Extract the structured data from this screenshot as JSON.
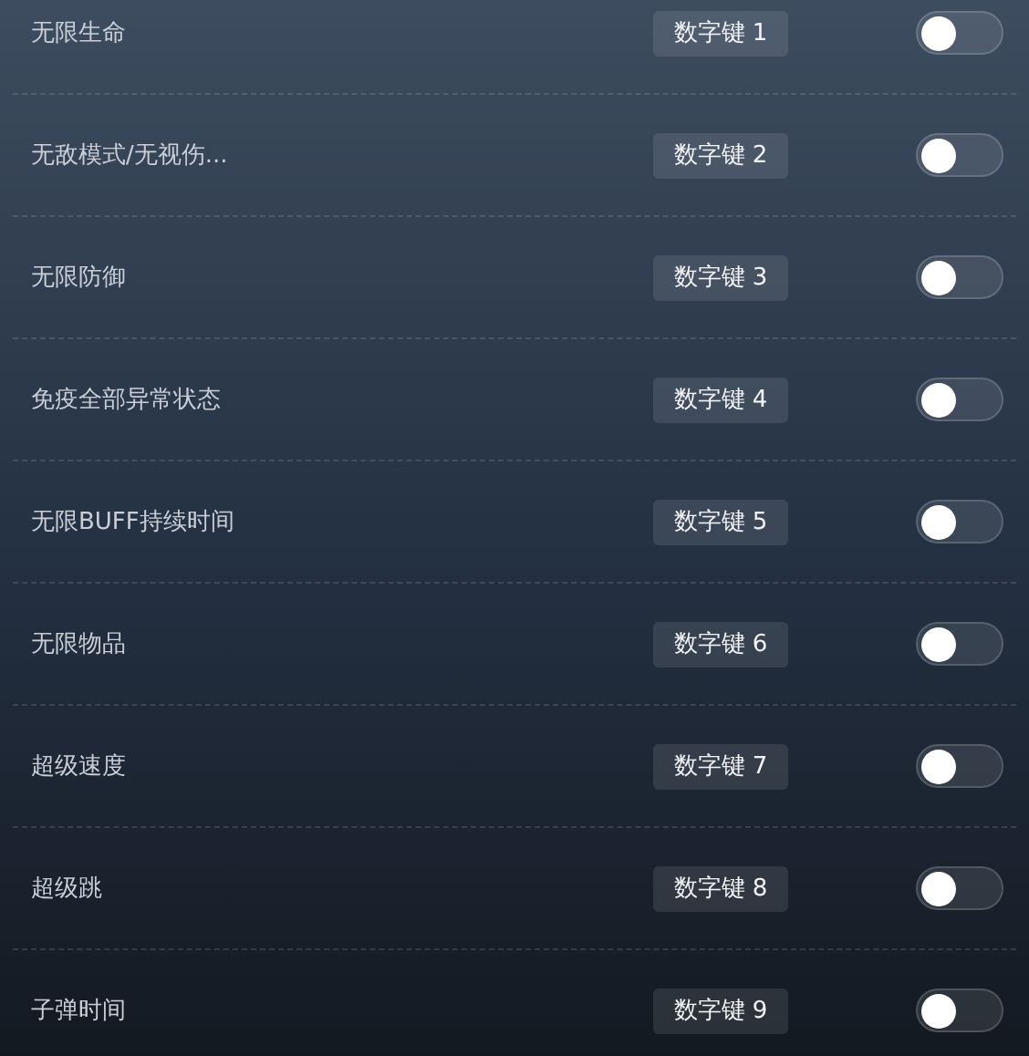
{
  "cheats": [
    {
      "label": "无限生命",
      "hotkey": "数字键 1",
      "on": false
    },
    {
      "label": "无敌模式/无视伤...",
      "hotkey": "数字键 2",
      "on": false
    },
    {
      "label": "无限防御",
      "hotkey": "数字键 3",
      "on": false
    },
    {
      "label": "免疫全部异常状态",
      "hotkey": "数字键 4",
      "on": false
    },
    {
      "label": "无限BUFF持续时间",
      "hotkey": "数字键 5",
      "on": false
    },
    {
      "label": "无限物品",
      "hotkey": "数字键 6",
      "on": false
    },
    {
      "label": "超级速度",
      "hotkey": "数字键 7",
      "on": false
    },
    {
      "label": "超级跳",
      "hotkey": "数字键 8",
      "on": false
    },
    {
      "label": "子弹时间",
      "hotkey": "数字键 9",
      "on": false
    }
  ]
}
